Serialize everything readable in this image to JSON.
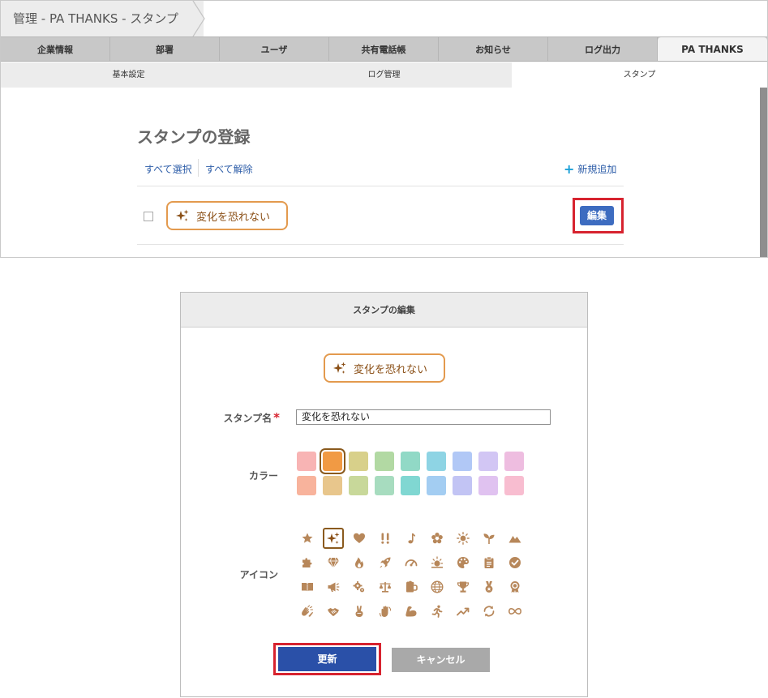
{
  "breadcrumb": "管理 - PA THANKS - スタンプ",
  "tabs": [
    "企業情報",
    "部署",
    "ユーザ",
    "共有電話帳",
    "お知らせ",
    "ログ出力",
    "PA THANKS"
  ],
  "active_tab": "PA THANKS",
  "subtabs": [
    "基本設定",
    "ログ管理",
    "スタンプ"
  ],
  "active_subtab": "スタンプ",
  "register": {
    "title": "スタンプの登録",
    "select_all": "すべて選択",
    "deselect_all": "すべて解除",
    "new_add": "新規追加",
    "stamp_label": "変化を恐れない",
    "edit_label": "編集"
  },
  "modal": {
    "title": "スタンプの編集",
    "preview_label": "変化を恐れない",
    "name_label": "スタンプ名",
    "required_mark": "*",
    "name_value": "変化を恐れない",
    "color_label": "カラー",
    "icon_label": "アイコン",
    "update_label": "更新",
    "cancel_label": "キャンセル",
    "stamp_color": "#e39a4e",
    "stamp_text_color": "#8a4f16",
    "selected_color_index": 1,
    "colors": [
      "#f8b4b4",
      "#f19a44",
      "#d8d08a",
      "#b2d9a3",
      "#91d9c6",
      "#8ed4e4",
      "#b1c8f6",
      "#d2c6f4",
      "#eebde0",
      "#f8b39c",
      "#e8c68c",
      "#c8d89a",
      "#a7dcbf",
      "#80d7d2",
      "#a3cdf2",
      "#c2c4f4",
      "#e0c2f0",
      "#f8bdd0"
    ],
    "selected_icon_index": 1,
    "icons": [
      "star-icon",
      "sparkles-icon",
      "heart-icon",
      "double-exclamation-icon",
      "music-note-icon",
      "flower-icon",
      "sun-icon",
      "sprout-icon",
      "mountain-icon",
      "puzzle-icon",
      "diamond-icon",
      "fire-icon",
      "rocket-icon",
      "gauge-icon",
      "sunrise-icon",
      "palette-icon",
      "clipboard-icon",
      "check-circle-icon",
      "book-icon",
      "megaphone-icon",
      "gears-icon",
      "balance-scale-icon",
      "beer-mug-icon",
      "globe-icon",
      "trophy-icon",
      "medal-icon",
      "award-icon",
      "clapping-hands-icon",
      "handshake-icon",
      "peace-hand-icon",
      "waving-hand-icon",
      "muscle-arm-icon",
      "running-person-icon",
      "trend-up-icon",
      "refresh-icon",
      "infinity-icon"
    ]
  }
}
